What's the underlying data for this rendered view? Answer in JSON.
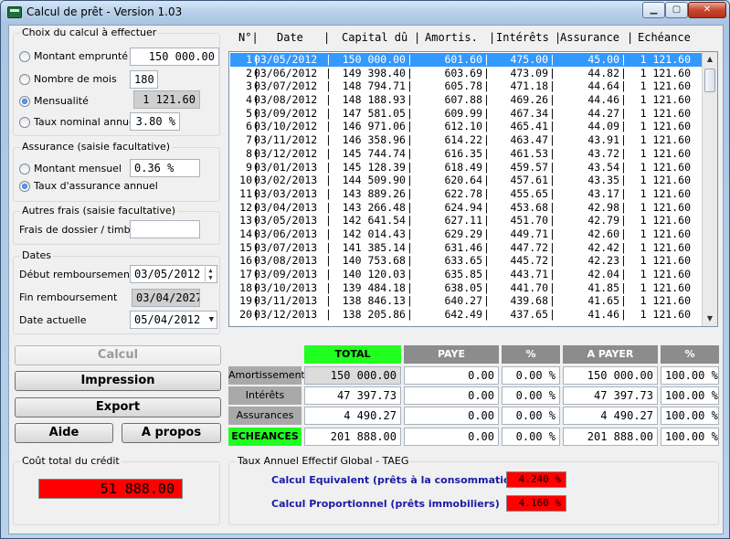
{
  "window": {
    "title": "Calcul de prêt - Version 1.03"
  },
  "loan": {
    "group_title": "Choix du calcul à effectuer",
    "options": [
      {
        "label": "Montant emprunté",
        "value": "150 000.00",
        "selected": false
      },
      {
        "label": "Nombre de mois",
        "value": "180",
        "selected": false
      },
      {
        "label": "Mensualité",
        "value": "1 121.60",
        "selected": true
      },
      {
        "label": "Taux nominal annuel",
        "value": "3.80 %",
        "selected": false
      }
    ]
  },
  "insurance": {
    "group_title": "Assurance (saisie facultative)",
    "options": [
      {
        "label": "Montant mensuel",
        "value": "0.36 %",
        "selected": false
      },
      {
        "label": "Taux d'assurance annuel",
        "selected": true
      }
    ]
  },
  "fees": {
    "group_title": "Autres frais (saisie facultative)",
    "label": "Frais de dossier / timbre",
    "value": ""
  },
  "dates": {
    "group_title": "Dates",
    "start_label": "Début remboursement",
    "start_value": "03/05/2012",
    "end_label": "Fin remboursement",
    "end_value": "03/04/2027",
    "current_label": "Date actuelle",
    "current_value": "05/04/2012"
  },
  "table": {
    "headers": [
      "N°|",
      "Date",
      "|",
      "Capital dû",
      "|",
      "Amortis.",
      "|",
      "Intérêts",
      "|",
      "Assurance",
      "|",
      "Echéance"
    ],
    "rows": [
      [
        "1",
        "03/05/2012",
        "150 000.00",
        "601.60",
        "475.00",
        "45.00",
        "1 121.60"
      ],
      [
        "2",
        "03/06/2012",
        "149 398.40",
        "603.69",
        "473.09",
        "44.82",
        "1 121.60"
      ],
      [
        "3",
        "03/07/2012",
        "148 794.71",
        "605.78",
        "471.18",
        "44.64",
        "1 121.60"
      ],
      [
        "4",
        "03/08/2012",
        "148 188.93",
        "607.88",
        "469.26",
        "44.46",
        "1 121.60"
      ],
      [
        "5",
        "03/09/2012",
        "147 581.05",
        "609.99",
        "467.34",
        "44.27",
        "1 121.60"
      ],
      [
        "6",
        "03/10/2012",
        "146 971.06",
        "612.10",
        "465.41",
        "44.09",
        "1 121.60"
      ],
      [
        "7",
        "03/11/2012",
        "146 358.96",
        "614.22",
        "463.47",
        "43.91",
        "1 121.60"
      ],
      [
        "8",
        "03/12/2012",
        "145 744.74",
        "616.35",
        "461.53",
        "43.72",
        "1 121.60"
      ],
      [
        "9",
        "03/01/2013",
        "145 128.39",
        "618.49",
        "459.57",
        "43.54",
        "1 121.60"
      ],
      [
        "10",
        "03/02/2013",
        "144 509.90",
        "620.64",
        "457.61",
        "43.35",
        "1 121.60"
      ],
      [
        "11",
        "03/03/2013",
        "143 889.26",
        "622.78",
        "455.65",
        "43.17",
        "1 121.60"
      ],
      [
        "12",
        "03/04/2013",
        "143 266.48",
        "624.94",
        "453.68",
        "42.98",
        "1 121.60"
      ],
      [
        "13",
        "03/05/2013",
        "142 641.54",
        "627.11",
        "451.70",
        "42.79",
        "1 121.60"
      ],
      [
        "14",
        "03/06/2013",
        "142 014.43",
        "629.29",
        "449.71",
        "42.60",
        "1 121.60"
      ],
      [
        "15",
        "03/07/2013",
        "141 385.14",
        "631.46",
        "447.72",
        "42.42",
        "1 121.60"
      ],
      [
        "16",
        "03/08/2013",
        "140 753.68",
        "633.65",
        "445.72",
        "42.23",
        "1 121.60"
      ],
      [
        "17",
        "03/09/2013",
        "140 120.03",
        "635.85",
        "443.71",
        "42.04",
        "1 121.60"
      ],
      [
        "18",
        "03/10/2013",
        "139 484.18",
        "638.05",
        "441.70",
        "41.85",
        "1 121.60"
      ],
      [
        "19",
        "03/11/2013",
        "138 846.13",
        "640.27",
        "439.68",
        "41.65",
        "1 121.60"
      ],
      [
        "20",
        "03/12/2013",
        "138 205.86",
        "642.49",
        "437.65",
        "41.46",
        "1 121.60"
      ]
    ]
  },
  "buttons": {
    "calcul": "Calcul",
    "impression": "Impression",
    "export": "Export",
    "aide": "Aide",
    "apropos": "A propos"
  },
  "summary": {
    "headers": [
      "TOTAL",
      "PAYE",
      "%",
      "A PAYER",
      "%"
    ],
    "rows": [
      {
        "label": "Amortissements",
        "total": "150 000.00",
        "paye": "0.00",
        "pct1": "0.00 %",
        "apayer": "150 000.00",
        "pct2": "100.00 %"
      },
      {
        "label": "Intérêts",
        "total": "47 397.73",
        "paye": "0.00",
        "pct1": "0.00 %",
        "apayer": "47 397.73",
        "pct2": "100.00 %"
      },
      {
        "label": "Assurances",
        "total": "4 490.27",
        "paye": "0.00",
        "pct1": "0.00 %",
        "apayer": "4 490.27",
        "pct2": "100.00 %"
      },
      {
        "label": "ECHEANCES",
        "total": "201 888.00",
        "paye": "0.00",
        "pct1": "0.00 %",
        "apayer": "201 888.00",
        "pct2": "100.00 %"
      }
    ]
  },
  "cost": {
    "group_title": "Coût total du crédit",
    "value": "51 888.00"
  },
  "taeg": {
    "group_title": "Taux Annuel Effectif Global - TAEG",
    "equiv_label": "Calcul Equivalent (prêts à la consommation)",
    "equiv_value": "4.240 %",
    "prop_label": "Calcul Proportionnel (prêts immobiliers)",
    "prop_value": "4.160 %"
  },
  "colors": {
    "accent_green": "#21ff21",
    "alert_red": "#ff0000",
    "selection_blue": "#3399ff"
  }
}
